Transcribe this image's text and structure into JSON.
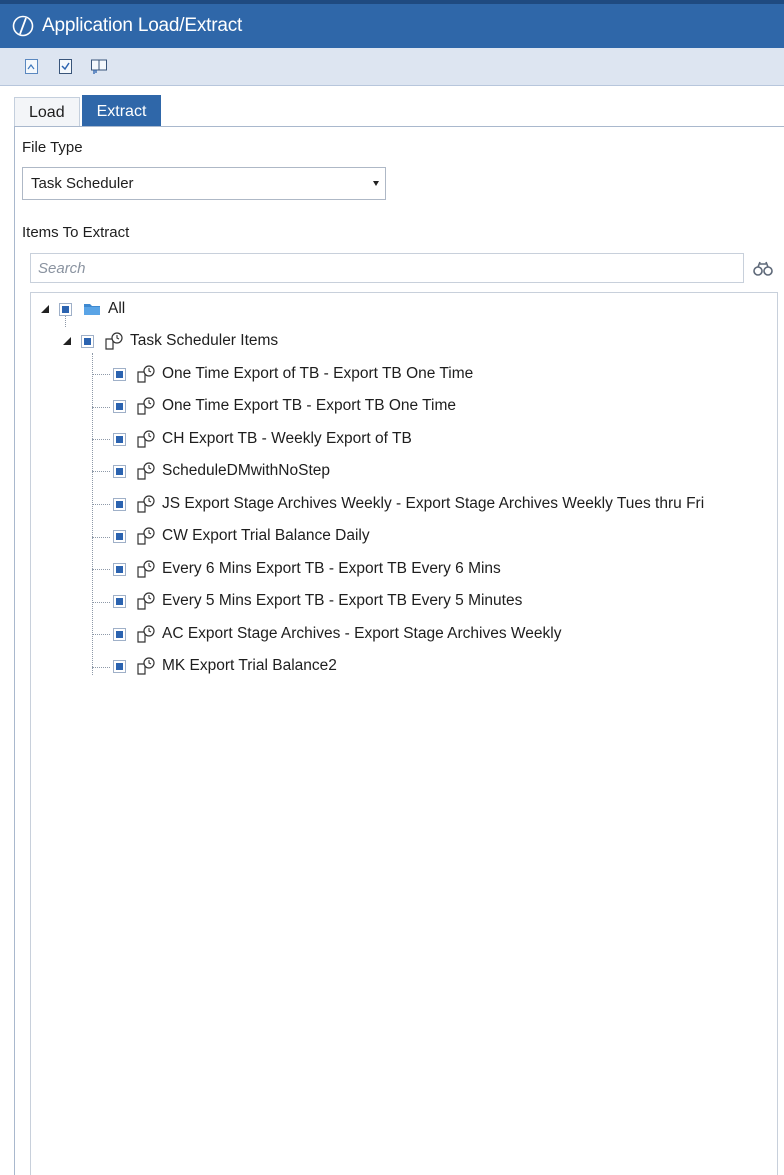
{
  "window": {
    "title": "Application Load/Extract"
  },
  "toolbar": {
    "buttons": [
      "import-icon",
      "export-icon",
      "reference-icon"
    ]
  },
  "tabs": [
    {
      "label": "Load",
      "active": false
    },
    {
      "label": "Extract",
      "active": true
    }
  ],
  "file_type": {
    "label": "File Type",
    "selected": "Task Scheduler"
  },
  "items": {
    "label": "Items To Extract"
  },
  "search": {
    "placeholder": "Search"
  },
  "tree": {
    "root": {
      "label": "All"
    },
    "group": {
      "label": "Task Scheduler Items"
    },
    "children": [
      "One Time Export of TB - Export TB One Time",
      "One Time Export TB - Export TB One Time",
      "CH Export TB - Weekly Export of TB",
      "ScheduleDMwithNoStep",
      "JS Export Stage Archives Weekly - Export Stage Archives Weekly Tues thru Fri",
      "CW Export Trial Balance Daily",
      "Every 6 Mins Export TB - Export TB Every 6 Mins",
      "Every 5 Mins Export TB - Export TB Every 5 Minutes",
      "AC Export Stage Archives - Export Stage Archives Weekly",
      "MK Export Trial Balance2"
    ]
  },
  "colors": {
    "titlebar": "#2f67a9",
    "toolbar": "#dde5f1",
    "check": "#2b63b0"
  }
}
